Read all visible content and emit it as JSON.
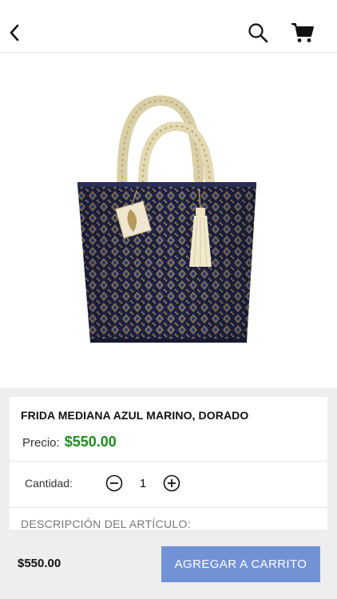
{
  "header": {
    "back_icon": "chevron-left-icon",
    "search_icon": "search-icon",
    "cart_icon": "cart-icon"
  },
  "product": {
    "image": "woven-tote-bag-navy-gold",
    "name": "FRIDA MEDIANA AZUL MARINO, DORADO",
    "price_label": "Precio:",
    "price": "$550.00",
    "quantity_label": "Cantidad:",
    "quantity": "1",
    "description_label": "DESCRIPCIÓN DEL ARTÍCULO:"
  },
  "footer": {
    "total": "$550.00",
    "add_to_cart_label": "AGREGAR A CARRITO"
  },
  "colors": {
    "price_green": "#1e8a1e",
    "button_blue": "#7292d6",
    "panel_grey": "#eeeeee"
  }
}
